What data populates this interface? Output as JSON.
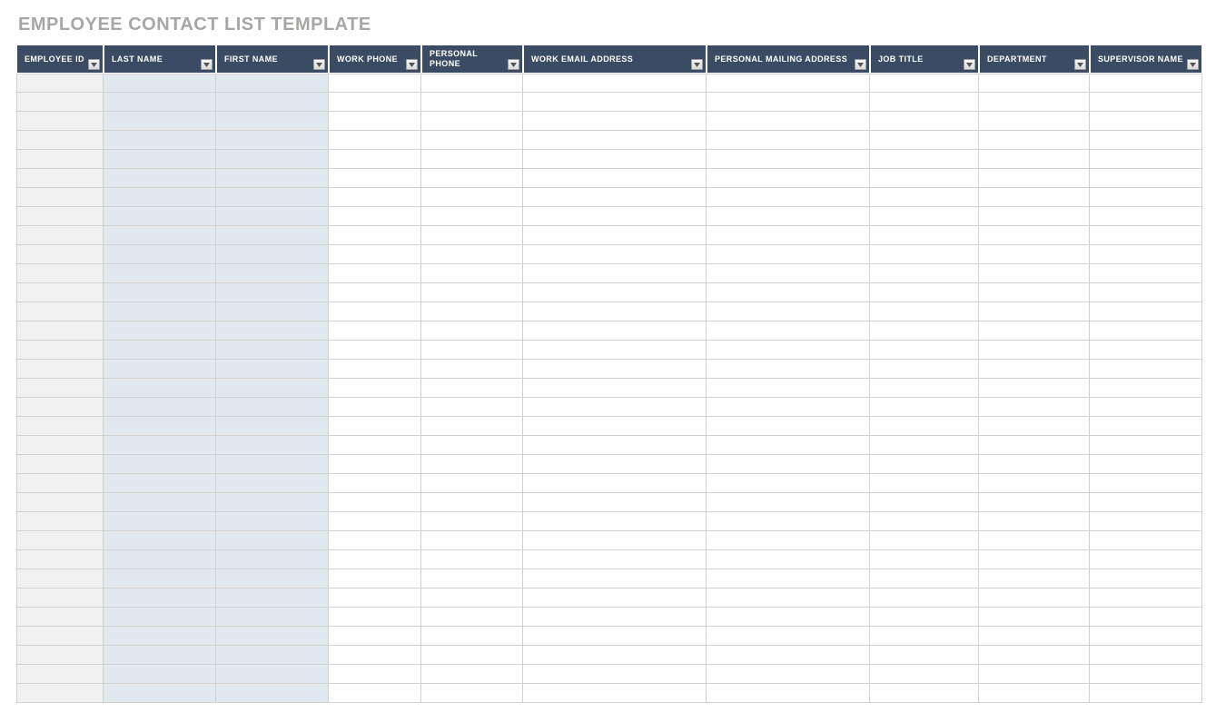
{
  "title": "EMPLOYEE CONTACT LIST TEMPLATE",
  "columns": [
    {
      "label": "EMPLOYEE ID"
    },
    {
      "label": "LAST NAME"
    },
    {
      "label": "FIRST NAME"
    },
    {
      "label": "WORK PHONE"
    },
    {
      "label": "PERSONAL PHONE"
    },
    {
      "label": "WORK EMAIL ADDRESS"
    },
    {
      "label": "PERSONAL MAILING ADDRESS"
    },
    {
      "label": "JOB TITLE"
    },
    {
      "label": "DEPARTMENT"
    },
    {
      "label": "SUPERVISOR NAME"
    }
  ],
  "row_count": 33
}
